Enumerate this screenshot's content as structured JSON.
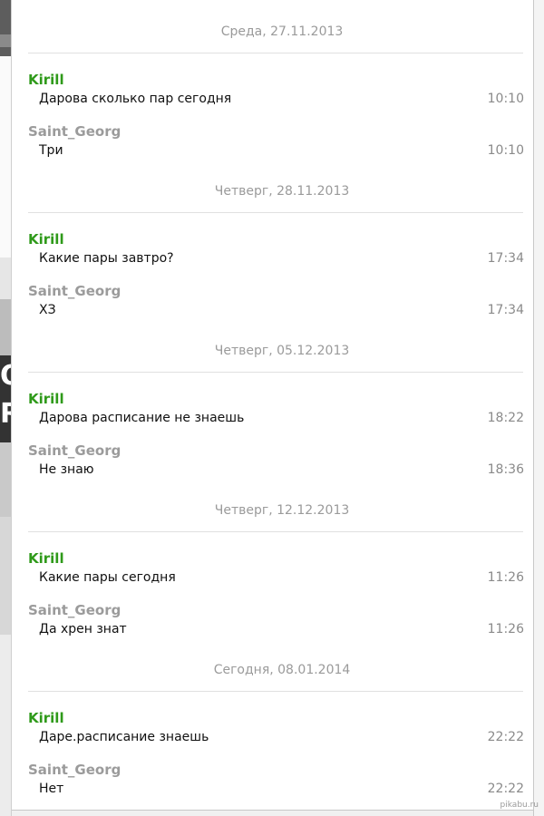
{
  "background_strip": {
    "glyph_1": "O",
    "glyph_2": "R"
  },
  "days": [
    {
      "header": "Среда, 27.11.2013",
      "messages": [
        {
          "sender": "Kirill",
          "text": "Дарова сколько пар сегодня",
          "time": "10:10"
        },
        {
          "sender": "Saint_Georg",
          "text": "Три",
          "time": "10:10"
        }
      ]
    },
    {
      "header": "Четверг, 28.11.2013",
      "messages": [
        {
          "sender": "Kirill",
          "text": "Какие пары завтро?",
          "time": "17:34"
        },
        {
          "sender": "Saint_Georg",
          "text": "ХЗ",
          "time": "17:34"
        }
      ]
    },
    {
      "header": "Четверг, 05.12.2013",
      "messages": [
        {
          "sender": "Kirill",
          "text": "Дарова расписание не знаешь",
          "time": "18:22"
        },
        {
          "sender": "Saint_Georg",
          "text": "Не знаю",
          "time": "18:36"
        }
      ]
    },
    {
      "header": "Четверг, 12.12.2013",
      "messages": [
        {
          "sender": "Kirill",
          "text": "Какие пары сегодня",
          "time": "11:26"
        },
        {
          "sender": "Saint_Georg",
          "text": "Да хрен знат",
          "time": "11:26"
        }
      ]
    },
    {
      "header": "Сегодня, 08.01.2014",
      "messages": [
        {
          "sender": "Kirill",
          "text": "Даре.расписание знаешь",
          "time": "22:22"
        },
        {
          "sender": "Saint_Georg",
          "text": "Нет",
          "time": "22:22"
        }
      ]
    }
  ],
  "watermark": "pikabu.ru",
  "colors": {
    "kirill": "#2f9a1a",
    "saint_georg": "#9b9b9b",
    "day_header": "#9a9a9a",
    "time": "#8a8a8a"
  }
}
